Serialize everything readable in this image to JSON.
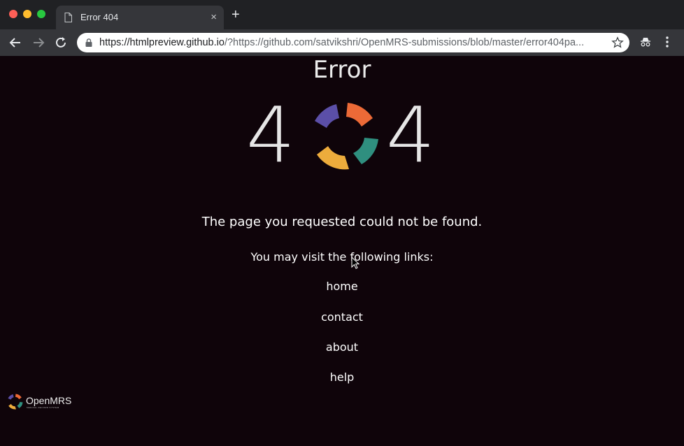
{
  "browser": {
    "tab": {
      "title": "Error 404",
      "close": "×"
    },
    "new_tab": "+",
    "url_host": "https://htmlpreview.github.io",
    "url_rest": "/?https://github.com/satvikshri/OpenMRS-submissions/blob/master/error404pa..."
  },
  "page": {
    "title": "Error",
    "digit_left": "4",
    "digit_right": "4",
    "message": "The page you requested could not be found.",
    "links_intro": "You may visit the following links:",
    "links": [
      "home",
      "contact",
      "about",
      "help"
    ]
  },
  "footer": {
    "brand": "OpenMRS",
    "tagline": "MEDICAL RECORD SYSTEM"
  },
  "colors": {
    "background": "#0f040a",
    "logo_purple": "#5b4fa8",
    "logo_orange": "#ec6a37",
    "logo_teal": "#2f8f7f",
    "logo_yellow": "#edac3c"
  },
  "icons": [
    "document-icon",
    "back-arrow-icon",
    "forward-arrow-icon",
    "reload-icon",
    "lock-icon",
    "star-icon",
    "incognito-icon",
    "kebab-menu-icon",
    "openmrs-logo-icon",
    "mouse-cursor-icon"
  ]
}
